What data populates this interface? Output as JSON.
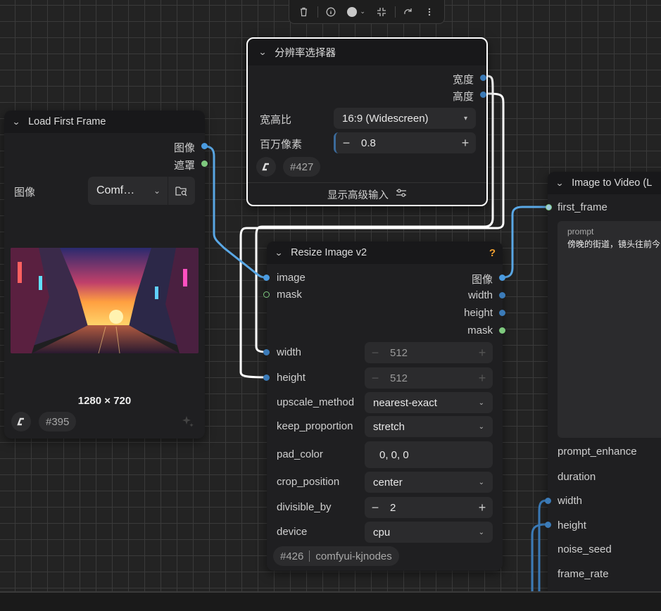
{
  "toolbar": {
    "items": [
      "trash-icon",
      "info-icon",
      "color-icon",
      "fit-icon",
      "redo-icon",
      "more-icon"
    ]
  },
  "resolution_node": {
    "title": "分辨率选择器",
    "outputs": [
      "宽度",
      "高度"
    ],
    "aspect_label": "宽高比",
    "aspect_value": "16:9 (Widescreen)",
    "megapixel_label": "百万像素",
    "megapixel_value": "0.8",
    "id": "#427",
    "advanced_label": "显示高级输入"
  },
  "load_node": {
    "title": "Load First Frame",
    "outputs": [
      "图像",
      "遮罩"
    ],
    "image_label": "图像",
    "image_value": "Comf…",
    "dimensions": "1280 × 720",
    "id": "#395"
  },
  "resize_node": {
    "title": "Resize Image v2",
    "help": "?",
    "inputs": [
      "image",
      "mask"
    ],
    "outputs": [
      "图像",
      "width",
      "height",
      "mask"
    ],
    "width_label": "width",
    "width_value": "512",
    "height_label": "height",
    "height_value": "512",
    "upscale_label": "upscale_method",
    "upscale_value": "nearest-exact",
    "keep_label": "keep_proportion",
    "keep_value": "stretch",
    "pad_label": "pad_color",
    "pad_value": "0, 0, 0",
    "crop_label": "crop_position",
    "crop_value": "center",
    "divisible_label": "divisible_by",
    "divisible_value": "2",
    "device_label": "device",
    "device_value": "cpu",
    "id": "#426",
    "source": "comfyui-kjnodes"
  },
  "i2v_node": {
    "title": "Image to Video (L",
    "first_frame": "first_frame",
    "prompt_label": "prompt",
    "prompt_text": "傍晚的街道，镜头往前今",
    "rows": [
      "prompt_enhance",
      "duration",
      "width",
      "height",
      "noise_seed",
      "frame_rate"
    ]
  },
  "colors": {
    "wire_blue": "#5aa8e6",
    "wire_white": "#ffffff",
    "accent_orange": "#f0a030",
    "mask_green": "#7ec97e"
  }
}
